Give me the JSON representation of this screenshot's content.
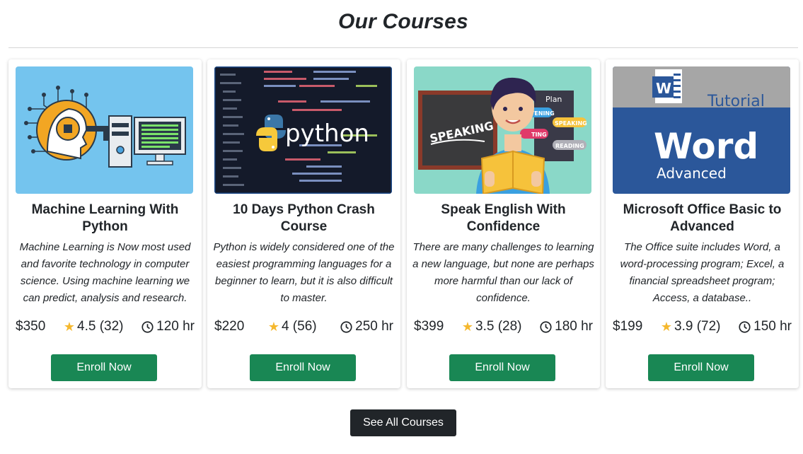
{
  "section": {
    "title": "Our Courses"
  },
  "courses": [
    {
      "title": "Machine Learning With Python",
      "description": "Machine Learning is Now most used and favorite technology in computer science. Using machine learning we can predict, analysis and research.",
      "price": "$350",
      "rating": "4.5 (32)",
      "duration": "120 hr",
      "enroll_label": "Enroll Now",
      "image": "machine-learning-illustration"
    },
    {
      "title": "10 Days Python Crash Course",
      "description": "Python is widely considered one of the easiest programming languages for a beginner to learn, but it is also difficult to master.",
      "price": "$220",
      "rating": "4 (56)",
      "duration": "250 hr",
      "enroll_label": "Enroll Now",
      "image": "python-code-editor",
      "image_text": "python"
    },
    {
      "title": "Speak English With Confidence",
      "description": "There are many challenges to learning a new language, but none are perhaps more harmful than our lack of confidence.",
      "price": "$399",
      "rating": "3.5 (28)",
      "duration": "180 hr",
      "enroll_label": "Enroll Now",
      "image": "speaking-illustration",
      "image_labels": {
        "board": "SPEAKING",
        "plan": "Plan",
        "listening": "LISTENING",
        "speaking": "SPEAKING",
        "writing": "TING",
        "reading": "READING"
      }
    },
    {
      "title": "Microsoft Office Basic to Advanced",
      "description": "The Office suite includes Word, a word-processing program; Excel, a financial spreadsheet program; Access, a database..",
      "price": "$199",
      "rating": "3.9 (72)",
      "duration": "150 hr",
      "enroll_label": "Enroll Now",
      "image": "word-tutorial-banner",
      "image_labels": {
        "logo": "W",
        "tutorial": "Tutorial",
        "word": "Word",
        "advanced": "Advanced"
      }
    }
  ],
  "see_all_label": "See All Courses",
  "colors": {
    "enroll": "#198754",
    "see_all": "#212529",
    "star": "#f5b82e"
  },
  "icons": {
    "rating": "star-icon",
    "duration": "clock-icon"
  }
}
